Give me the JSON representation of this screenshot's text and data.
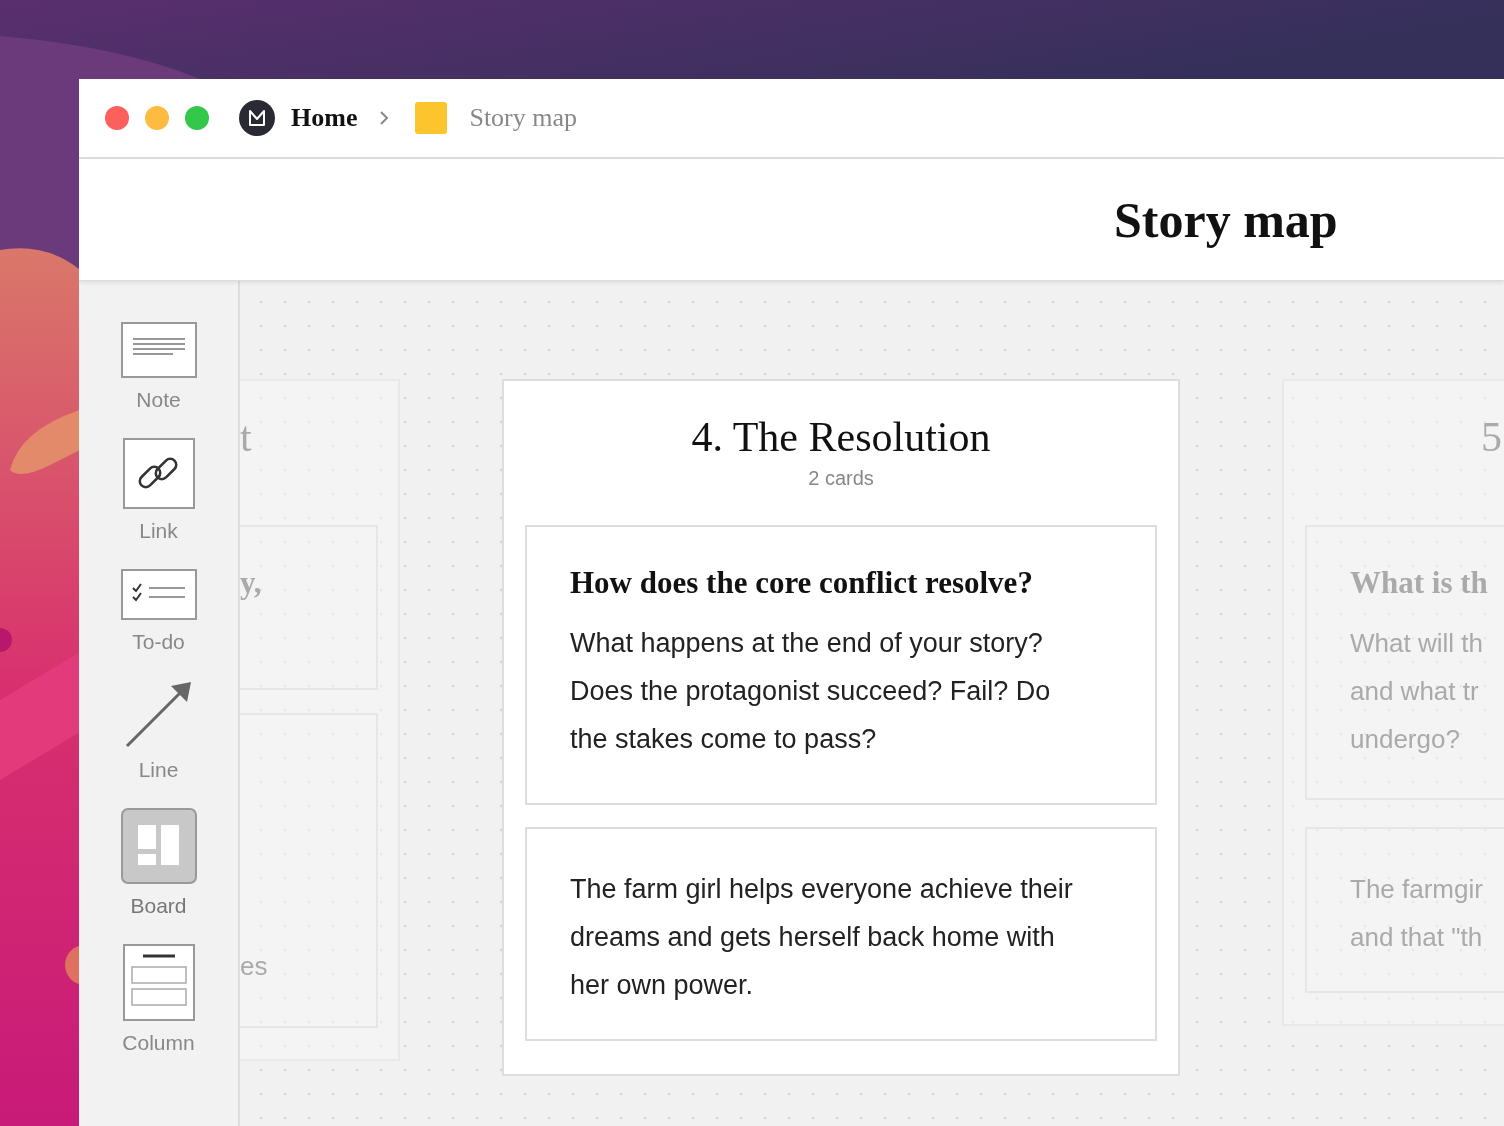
{
  "breadcrumb": [
    {
      "label": "Home",
      "kind": "home"
    },
    {
      "label": "Story map",
      "kind": "board"
    }
  ],
  "page_title": "Story map",
  "tools": [
    {
      "label": "Note",
      "kind": "note",
      "selected": false
    },
    {
      "label": "Link",
      "kind": "link",
      "selected": false
    },
    {
      "label": "To-do",
      "kind": "todo",
      "selected": false
    },
    {
      "label": "Line",
      "kind": "line",
      "selected": false
    },
    {
      "label": "Board",
      "kind": "board",
      "selected": true
    },
    {
      "label": "Column",
      "kind": "column",
      "selected": false
    }
  ],
  "columns": [
    {
      "title": "t",
      "focused": false,
      "cards": [
        {
          "heading": "y,"
        },
        {
          "lines": [
            "es"
          ]
        }
      ]
    },
    {
      "title": "4. The Resolution",
      "count": "2 cards",
      "focused": true,
      "cards": [
        {
          "heading": "How does the core conflict resolve?",
          "body": "What happens at the end of your story? Does the protagonist succeed? Fail? Do the stakes come to pass?"
        },
        {
          "body": "The farm girl helps everyone achieve their dreams and gets herself back home with her own power."
        }
      ]
    },
    {
      "title": "5",
      "focused": false,
      "cards": [
        {
          "heading": "What is th",
          "lines": [
            "What will th",
            "and what tr",
            "undergo?"
          ]
        },
        {
          "lines": [
            "The farmgir",
            "and that \"th"
          ]
        }
      ]
    }
  ]
}
